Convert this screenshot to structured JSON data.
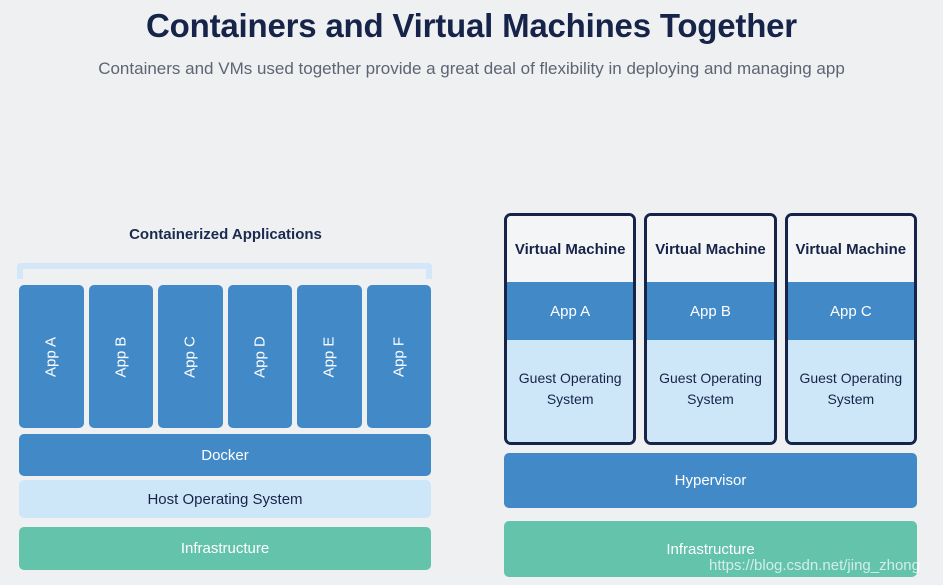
{
  "header": {
    "title": "Containers and Virtual Machines Together",
    "subtitle": "Containers and VMs used together provide a great deal of flexibility in deploying and managing app"
  },
  "colors": {
    "background": "#eff0f2",
    "title_navy": "#172449",
    "subtitle_gray": "#5d6472",
    "blue": "#4289c8",
    "light_blue": "#cee7f8",
    "bracket_blue": "#d3e7f8",
    "green": "#63c3ab",
    "vm_border": "#172449",
    "vm_header_bg": "#f4f5f6"
  },
  "left_column": {
    "title": "Containerized Applications",
    "apps": [
      {
        "label": "App A"
      },
      {
        "label": "App B"
      },
      {
        "label": "App C"
      },
      {
        "label": "App D"
      },
      {
        "label": "App E"
      },
      {
        "label": "App F"
      }
    ],
    "docker_label": "Docker",
    "host_os_label": "Host Operating System",
    "infrastructure_label": "Infrastructure"
  },
  "right_column": {
    "vms": [
      {
        "title": "Virtual Machine",
        "app": "App A",
        "guest_os": "Guest Operating System"
      },
      {
        "title": "Virtual Machine",
        "app": "App B",
        "guest_os": "Guest Operating System"
      },
      {
        "title": "Virtual Machine",
        "app": "App C",
        "guest_os": "Guest Operating System"
      }
    ],
    "hypervisor_label": "Hypervisor",
    "infrastructure_label": "Infrastructure"
  },
  "watermark": {
    "text": "https://blog.csdn.net/jing_zhong"
  }
}
